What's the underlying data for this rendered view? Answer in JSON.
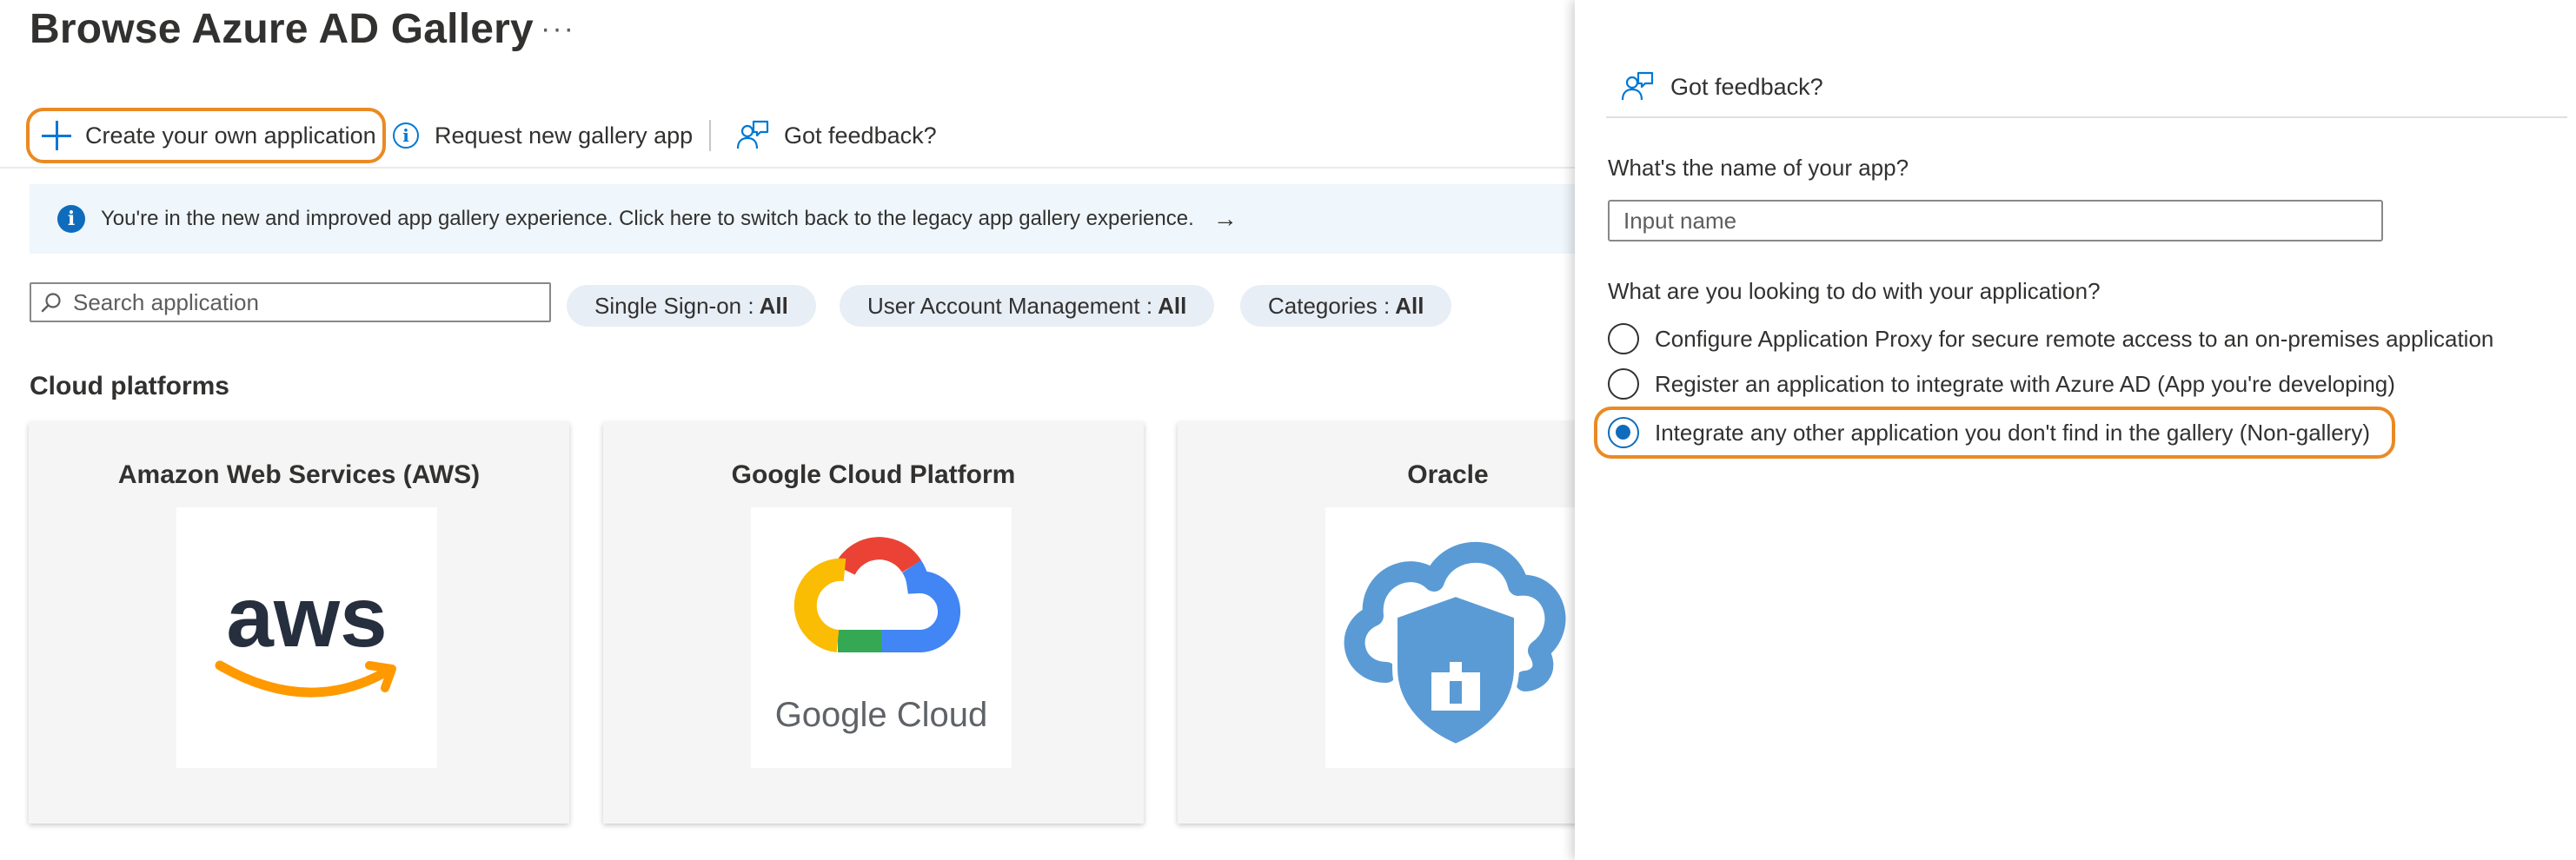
{
  "page": {
    "title": "Browse Azure AD Gallery",
    "more": "···"
  },
  "toolbar": {
    "create_label": "Create your own application",
    "request_label": "Request new gallery app",
    "feedback_label": "Got feedback?"
  },
  "banner": {
    "text": "You're in the new and improved app gallery experience. Click here to switch back to the legacy app gallery experience.",
    "arrow": "→"
  },
  "search": {
    "placeholder": "Search application"
  },
  "filters": [
    {
      "label": "Single Sign-on :",
      "value": "All"
    },
    {
      "label": "User Account Management :",
      "value": "All"
    },
    {
      "label": "Categories :",
      "value": "All"
    }
  ],
  "section": {
    "title": "Cloud platforms"
  },
  "cards": [
    {
      "title": "Amazon Web Services (AWS)",
      "logo_text": "aws",
      "icon": "aws-logo"
    },
    {
      "title": "Google Cloud Platform",
      "logo_text": "Google Cloud",
      "icon": "google-cloud-logo"
    },
    {
      "title": "Oracle",
      "icon": "oracle-cloud-shield-logo"
    }
  ],
  "panel": {
    "feedback_label": "Got feedback?",
    "name_question": "What's the name of your app?",
    "name_placeholder": "Input name",
    "purpose_question": "What are you looking to do with your application?",
    "options": [
      {
        "label": "Configure Application Proxy for secure remote access to an on-premises application",
        "selected": false
      },
      {
        "label": "Register an application to integrate with Azure AD (App you're developing)",
        "selected": false
      },
      {
        "label": "Integrate any other application you don't find in the gallery (Non-gallery)",
        "selected": true
      }
    ]
  },
  "colors": {
    "accent": "#0078d4",
    "highlight": "#ea8a23",
    "banner_bg": "#eff6fc",
    "pill_bg": "#e8eef6"
  }
}
